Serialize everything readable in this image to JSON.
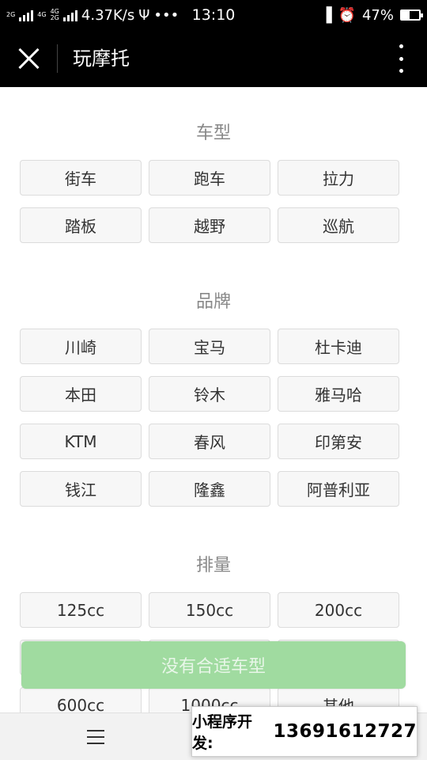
{
  "status_bar": {
    "net_labels": [
      "2G",
      "4G",
      "4G",
      "2G"
    ],
    "speed": "4.37K/s",
    "usb_icon": "usb-icon",
    "more": "•••",
    "time": "13:10",
    "battery_percent": "47%",
    "battery_level": 0.47
  },
  "title_bar": {
    "title": "玩摩托"
  },
  "sections": {
    "type": {
      "title": "车型",
      "options": [
        "街车",
        "跑车",
        "拉力",
        "踏板",
        "越野",
        "巡航"
      ]
    },
    "brand": {
      "title": "品牌",
      "options": [
        "川崎",
        "宝马",
        "杜卡迪",
        "本田",
        "铃木",
        "雅马哈",
        "KTM",
        "春风",
        "印第安",
        "钱江",
        "隆鑫",
        "阿普利亚"
      ]
    },
    "displacement": {
      "title": "排量",
      "options": [
        "125cc",
        "150cc",
        "200cc",
        "",
        "",
        "",
        "600cc",
        "1000cc",
        "其他"
      ]
    }
  },
  "action_button": {
    "label": "没有合适车型"
  },
  "dev_badge": {
    "label": "小程序开发:",
    "phone": "13691612727"
  },
  "colors": {
    "header_bg": "#000000",
    "button_green": "#a0dba0",
    "option_bg": "#f7f7f7"
  }
}
